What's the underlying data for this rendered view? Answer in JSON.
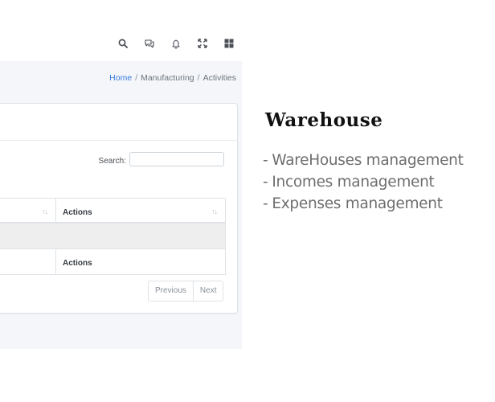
{
  "topbar": {
    "icons": [
      "search-icon",
      "chat-icon",
      "bell-icon",
      "fullscreen-icon",
      "grid-icon"
    ]
  },
  "breadcrumb": {
    "items": [
      "Home",
      "Manufacturing",
      "Activities"
    ],
    "separator": "/"
  },
  "table": {
    "search_label": "Search:",
    "search_value": "",
    "header_actions": "Actions",
    "footer_actions": "Actions",
    "sort_glyph": "↑↓"
  },
  "pagination": {
    "previous": "Previous",
    "next": "Next"
  },
  "promo": {
    "title": "Warehouse",
    "dash": "-",
    "features": [
      "WareHouses management",
      "Incomes management",
      "Expenses management"
    ]
  },
  "colors": {
    "link": "#3b7ddd",
    "app_background": "#f4f6f9",
    "empty_row": "#eeeeee"
  }
}
